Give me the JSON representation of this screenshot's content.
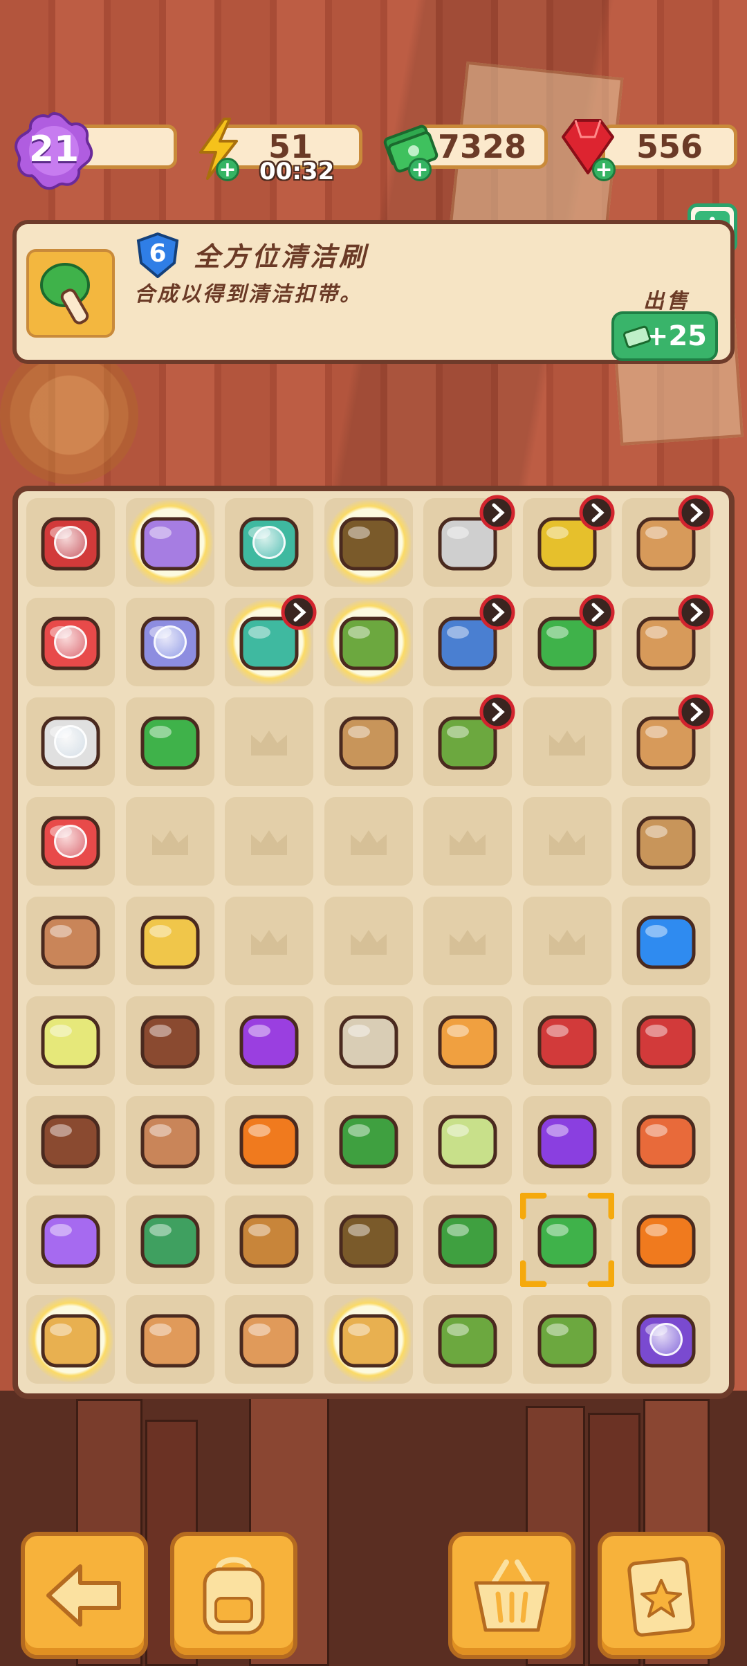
{
  "hud": {
    "level": "21",
    "energy": "51",
    "energy_timer": "00:32",
    "cash": "7328",
    "gems": "556",
    "colors": {
      "energy": "#f2b81d",
      "cash": "#2fa94e",
      "gems": "#d8202c",
      "level": "#a44fd6"
    }
  },
  "info_panel": {
    "level": "6",
    "title": "全方位清洁刷",
    "description": "合成以得到清洁扣带。",
    "sell_label": "出售",
    "sell_value": "+25",
    "info_icon": "i"
  },
  "board": {
    "columns": 7,
    "rows": 9,
    "cells": [
      {
        "name": "red-toolbox-locked",
        "color": "#d23a3a",
        "locked": true
      },
      {
        "name": "purple-hover-glowing",
        "color": "#a67de2",
        "glow": true
      },
      {
        "name": "first-aid-kit",
        "color": "#3fb9a0",
        "locked": true
      },
      {
        "name": "plant-pot-glowing",
        "color": "#7a5a2a",
        "glow": true
      },
      {
        "name": "evidence-tray-timer",
        "color": "#cfcfcf",
        "timer": true
      },
      {
        "name": "yellow-bucket-timer",
        "color": "#e6c02c",
        "timer": true
      },
      {
        "name": "cardboard-box-timer",
        "color": "#d79a5a",
        "timer": true
      },
      {
        "name": "white-toolbox",
        "color": "#e84a4a",
        "locked": true
      },
      {
        "name": "hover-boat",
        "color": "#8d8de0",
        "locked": true
      },
      {
        "name": "medicine-glowing-timer",
        "color": "#3fb9a0",
        "glow": true,
        "timer": true
      },
      {
        "name": "plant-pot-glowing-2",
        "color": "#6ca83f",
        "glow": true
      },
      {
        "name": "evidence-magnifier-timer",
        "color": "#4a7fd1",
        "timer": true
      },
      {
        "name": "yellow-case-timer",
        "color": "#3fb24a",
        "timer": true
      },
      {
        "name": "pottery-box-timer",
        "color": "#d79a5a",
        "timer": true
      },
      {
        "name": "white-robot-locked",
        "color": "#e0e0e0",
        "locked": true
      },
      {
        "name": "cash-stack",
        "color": "#3fb24a"
      },
      {
        "name": "empty"
      },
      {
        "name": "wooden-drum",
        "color": "#c8955a"
      },
      {
        "name": "evidence-board-timer",
        "color": "#6ca83f",
        "timer": true
      },
      {
        "name": "empty"
      },
      {
        "name": "wood-crate-timer",
        "color": "#d79a5a",
        "timer": true
      },
      {
        "name": "red-robot-locked",
        "color": "#e84a4a",
        "locked": true
      },
      {
        "name": "empty"
      },
      {
        "name": "empty"
      },
      {
        "name": "empty"
      },
      {
        "name": "empty"
      },
      {
        "name": "empty"
      },
      {
        "name": "evidence-bag",
        "color": "#c8955a"
      },
      {
        "name": "flower-pot",
        "color": "#c98559"
      },
      {
        "name": "road-barrier",
        "color": "#f0c64a"
      },
      {
        "name": "empty"
      },
      {
        "name": "empty"
      },
      {
        "name": "empty"
      },
      {
        "name": "empty"
      },
      {
        "name": "energy-orb-blue",
        "color": "#2f8bf0"
      },
      {
        "name": "soap-bottle",
        "color": "#e6e87a"
      },
      {
        "name": "brown-envelopes",
        "color": "#8a4a30"
      },
      {
        "name": "purple-blob",
        "color": "#9a3fe0"
      },
      {
        "name": "evidence-bag-shoes",
        "color": "#d9cdb5"
      },
      {
        "name": "goggles",
        "color": "#f0a040"
      },
      {
        "name": "trowel",
        "color": "#d23a3a"
      },
      {
        "name": "axe-hammer",
        "color": "#d23a3a"
      },
      {
        "name": "brown-envelopes-2",
        "color": "#8a4a30"
      },
      {
        "name": "broken-pot",
        "color": "#c98559"
      },
      {
        "name": "energy-orb-orange",
        "color": "#f07a1e"
      },
      {
        "name": "berry-bush",
        "color": "#3fa040"
      },
      {
        "name": "lime-slice",
        "color": "#c8e08a"
      },
      {
        "name": "purple-star",
        "color": "#8a3fe0"
      },
      {
        "name": "flower-basket",
        "color": "#e86a3a"
      },
      {
        "name": "energy-orb-purple",
        "color": "#a66af0"
      },
      {
        "name": "blossom-tree",
        "color": "#3fa060"
      },
      {
        "name": "binoculars",
        "color": "#c8853a"
      },
      {
        "name": "tool-stand",
        "color": "#7a5a2a"
      },
      {
        "name": "green-sponge",
        "color": "#3fa040"
      },
      {
        "name": "cleaning-brush-selected",
        "color": "#3fb24a",
        "selected": true
      },
      {
        "name": "traffic-barrier",
        "color": "#f07a1e"
      },
      {
        "name": "carousel-glowing",
        "color": "#e8b050",
        "glow": true
      },
      {
        "name": "cardboard-flat-stack",
        "color": "#e09a5a"
      },
      {
        "name": "cardboard-flat",
        "color": "#e09a5a"
      },
      {
        "name": "bottle-glowing",
        "color": "#e8b050",
        "glow": true
      },
      {
        "name": "vacuum-hose",
        "color": "#6ca83f"
      },
      {
        "name": "spray-bottle",
        "color": "#6ca83f"
      },
      {
        "name": "purple-moth-locked",
        "color": "#7a4ad0",
        "locked": true
      }
    ]
  },
  "bottom_bar": {
    "back_icon": "arrow-left-icon",
    "backpack_icon": "backpack-icon",
    "basket_icon": "basket-icon",
    "clipboard_icon": "clipboard-star-icon"
  }
}
